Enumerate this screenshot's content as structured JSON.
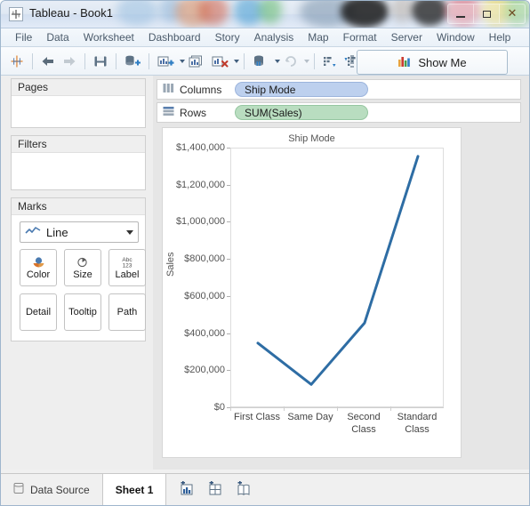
{
  "window": {
    "title": "Tableau - Book1",
    "app_icon": "tableau-logo-icon",
    "controls": {
      "minimize": "–",
      "maximize": "□",
      "close": "✕"
    }
  },
  "menubar": {
    "items": [
      {
        "label": "File"
      },
      {
        "label": "Data"
      },
      {
        "label": "Worksheet"
      },
      {
        "label": "Dashboard"
      },
      {
        "label": "Story"
      },
      {
        "label": "Analysis"
      },
      {
        "label": "Map"
      },
      {
        "label": "Format"
      },
      {
        "label": "Server"
      },
      {
        "label": "Window"
      },
      {
        "label": "Help"
      }
    ]
  },
  "toolbar": {
    "show_me_label": "Show Me",
    "icons": [
      "tableau-home-icon",
      "back-arrow-icon",
      "forward-arrow-icon",
      "save-icon",
      "new-data-source-icon",
      "new-worksheet-icon",
      "duplicate-sheet-icon",
      "clear-sheet-icon",
      "swap-rows-columns-icon",
      "refresh-data-source-icon",
      "sort-ascending-icon",
      "sort-descending-icon"
    ]
  },
  "left_panel": {
    "pages": {
      "title": "Pages"
    },
    "filters": {
      "title": "Filters"
    },
    "marks": {
      "title": "Marks",
      "mark_type": "Line",
      "mark_type_icon": "line-chart-icon",
      "buttons": [
        {
          "label": "Color",
          "icon": "color-palette-icon"
        },
        {
          "label": "Size",
          "icon": "size-circle-icon"
        },
        {
          "label": "Label",
          "icon": "abc-123-icon"
        },
        {
          "label": "Detail",
          "icon": ""
        },
        {
          "label": "Tooltip",
          "icon": ""
        },
        {
          "label": "Path",
          "icon": ""
        }
      ]
    }
  },
  "shelves": {
    "columns": {
      "label": "Columns",
      "icon": "columns-icon",
      "pill": "Ship Mode"
    },
    "rows": {
      "label": "Rows",
      "icon": "rows-icon",
      "pill": "SUM(Sales)"
    }
  },
  "chart_data": {
    "type": "line",
    "title": "Ship Mode",
    "xlabel": "",
    "ylabel": "Sales",
    "categories": [
      "First Class",
      "Same Day",
      "Second Class",
      "Standard Class"
    ],
    "values": [
      351000,
      128000,
      460000,
      1358000
    ],
    "ylim": [
      0,
      1400000
    ],
    "ytick_values": [
      0,
      200000,
      400000,
      600000,
      800000,
      1000000,
      1200000,
      1400000
    ],
    "ytick_labels": [
      "$0",
      "$200,000",
      "$400,000",
      "$600,000",
      "$800,000",
      "$1,000,000",
      "$1,200,000",
      "$1,400,000"
    ],
    "grid": false,
    "legend": "none",
    "line_color": "#2e6da4",
    "line_width": 3
  },
  "statusbar": {
    "data_source_tab": {
      "label": "Data Source",
      "icon": "data-source-icon"
    },
    "sheet_tab": {
      "label": "Sheet 1"
    },
    "icons": [
      "new-worksheet-icon",
      "new-dashboard-icon",
      "new-story-icon"
    ]
  }
}
